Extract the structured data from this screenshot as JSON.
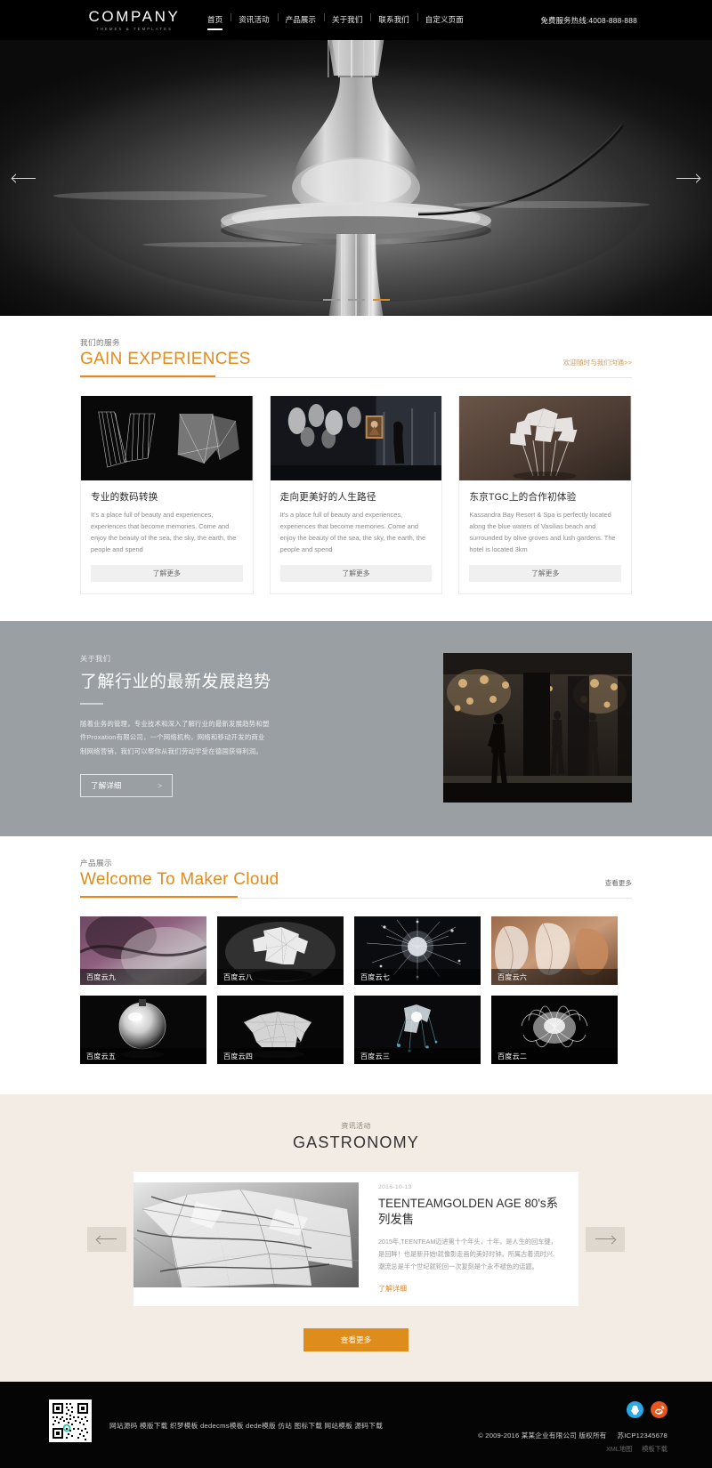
{
  "header": {
    "logo_main": "COMPANY",
    "logo_sub": "THEMES & TEMPLATES",
    "nav": [
      {
        "label": "首页",
        "active": true
      },
      {
        "label": "资讯活动",
        "active": false
      },
      {
        "label": "产品展示",
        "active": false
      },
      {
        "label": "关于我们",
        "active": false
      },
      {
        "label": "联系我们",
        "active": false
      },
      {
        "label": "自定义页面",
        "active": false
      }
    ],
    "hotline": "免费服务热线:4008-888-888"
  },
  "hero": {
    "prev_icon": "arrow-left-icon",
    "next_icon": "arrow-right-icon",
    "dots": [
      "1",
      "2",
      "3"
    ],
    "active_dot": 2
  },
  "services": {
    "zh_title": "我们的服务",
    "en_title": "GAIN EXPERIENCES",
    "more": "欢迎随时与我们沟通>>",
    "cards": [
      {
        "title": "专业的数码转换",
        "text": "It's a place full of beauty and experiences, experiences that become memories. Come and enjoy the beauty of the sea, the sky, the earth, the people and spend",
        "button": "了解更多"
      },
      {
        "title": "走向更美好的人生路径",
        "text": "It's a place full of beauty and experiences, experiences that become memories. Come and enjoy the beauty of the sea, the sky, the earth, the people and spend",
        "button": "了解更多"
      },
      {
        "title": "东京TGC上的合作初体验",
        "text": "Kassandra Bay Resort & Spa is perfectly located along the blue waters of Vasilias beach and surrounded by olive groves and lush gardens. The hotel is located 3km",
        "button": "了解更多"
      }
    ]
  },
  "about": {
    "zh_label": "关于我们",
    "title": "了解行业的最新发展趋势",
    "text": "随着业务的管理，专业技术和深入了解行业的最新发展趋势和塑件Proxation有限公司，一个网络机构，网络和移动开发的商业制网络营销，我们可以帮你从我们劳动学受在德国获得利润。",
    "button": "了解详细",
    "button_arrow": ">"
  },
  "products": {
    "zh_title": "产品展示",
    "en_title": "Welcome To Maker Cloud",
    "more": "查看更多",
    "items": [
      {
        "label": "百度云九"
      },
      {
        "label": "百度云八"
      },
      {
        "label": "百度云七"
      },
      {
        "label": "百度云六"
      },
      {
        "label": "百度云五"
      },
      {
        "label": "百度云四"
      },
      {
        "label": "百度云三"
      },
      {
        "label": "百度云二"
      }
    ]
  },
  "news": {
    "zh_title": "资讯活动",
    "en_title": "GASTRONOMY",
    "prev_icon": "arrow-left-icon",
    "next_icon": "arrow-right-icon",
    "article": {
      "date": "2016-10-13",
      "title": "TEENTEAMGOLDEN AGE 80's系列发售",
      "text": "2015年,TEENTEAM迈进第十个年头，十年，是人生的回车键，是回眸！也是新开始!就像影走画的美好时钟。所属古着流时兴,潮流总是半个世纪就轮回一次复刻是个永不褪色的话题。",
      "link": "了解详细"
    },
    "more_button": "查看更多"
  },
  "footer": {
    "links": "网站源码 模版下载 织梦模板 dedecms模板 dede模版 仿站 图标下载 网站模板 源码下载",
    "socials": [
      {
        "name": "qq-icon",
        "label": "QQ"
      },
      {
        "name": "weibo-icon",
        "label": "微博"
      }
    ],
    "copyright": "© 2009-2016 某某企业有限公司 版权所有",
    "icp": "苏ICP12345678",
    "sub_links": [
      "XML地图",
      "模板下载"
    ]
  },
  "colors": {
    "accent": "#e08b1d",
    "accent_button": "#de8c1b",
    "about_bg": "#9a9fa3",
    "news_bg": "#f2ece4",
    "header_bg": "#000000",
    "footer_bg": "#050505"
  }
}
